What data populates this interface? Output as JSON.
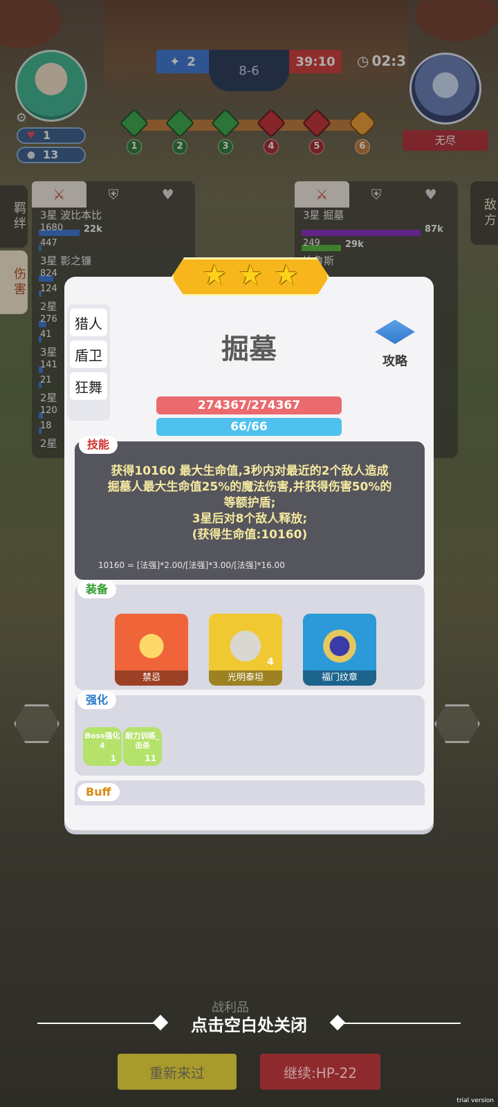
{
  "hud": {
    "lives": "1",
    "coins": "13",
    "score_blue": "2",
    "score_mid": "8-6",
    "score_red": "39:10",
    "timer": "02:3",
    "enemy_label": "无尽"
  },
  "stages": [
    {
      "num": "1",
      "state": "green"
    },
    {
      "num": "2",
      "state": "green"
    },
    {
      "num": "3",
      "state": "green"
    },
    {
      "num": "4",
      "state": "red"
    },
    {
      "num": "5",
      "state": "red"
    },
    {
      "num": "6",
      "state": "skull"
    }
  ],
  "side_tabs": {
    "left_top": "羁绊",
    "left_active": "伤害",
    "right": "敌方"
  },
  "left_panel": {
    "rows": [
      {
        "type": "name",
        "text": "3星 波比本比"
      },
      {
        "type": "bar",
        "text": "1680",
        "value": "22k",
        "color": "#3d78d6",
        "fill": 0.28
      },
      {
        "type": "bar",
        "text": "447",
        "value": "",
        "color": "#3d78d6",
        "fill": 0.02
      },
      {
        "type": "name",
        "text": "3星 影之镰"
      },
      {
        "type": "bar",
        "text": "824",
        "value": "",
        "color": "#3d78d6",
        "fill": 0.1
      },
      {
        "type": "bar",
        "text": "124",
        "value": "",
        "color": "#3d78d6",
        "fill": 0.02
      },
      {
        "type": "name",
        "text": "2星"
      },
      {
        "type": "bar",
        "text": "276",
        "value": "",
        "color": "#3d78d6",
        "fill": 0.05
      },
      {
        "type": "bar",
        "text": "41",
        "value": "",
        "color": "#3d78d6",
        "fill": 0.02
      },
      {
        "type": "name",
        "text": "3星"
      },
      {
        "type": "bar",
        "text": "141",
        "value": "",
        "color": "#3d78d6",
        "fill": 0.03
      },
      {
        "type": "bar",
        "text": "21",
        "value": "",
        "color": "#3d78d6",
        "fill": 0.02
      },
      {
        "type": "name",
        "text": "2星"
      },
      {
        "type": "bar",
        "text": "120",
        "value": "",
        "color": "#3d78d6",
        "fill": 0.03
      },
      {
        "type": "bar",
        "text": "18",
        "value": "",
        "color": "#3d78d6",
        "fill": 0.02
      },
      {
        "type": "name",
        "text": "2星"
      }
    ]
  },
  "right_panel": {
    "rows": [
      {
        "type": "name",
        "text": "3星 掘墓"
      },
      {
        "type": "bar",
        "text": "",
        "value": "87k",
        "color": "#8a2ec8",
        "fill": 0.82
      },
      {
        "type": "bar",
        "text": "249",
        "value": "29k",
        "color": "#58b83a",
        "fill": 0.27
      },
      {
        "type": "name",
        "text": "比鲁斯"
      }
    ]
  },
  "modal": {
    "traits": [
      "猎人",
      "盾卫",
      "狂舞"
    ],
    "hero_name": "掘墓",
    "guide_label": "攻略",
    "hp_text": "274367/274367",
    "mp_text": "66/66",
    "skill": {
      "tag": "技能",
      "lines": [
        "获得10160 最大生命值,3秒内对最近的2个敌人造成",
        "掘墓人最大生命值25%的魔法伤害,并获得伤害50%的",
        "等额护盾;",
        "3星后对8个敌人释放;",
        "(获得生命值:10160)"
      ],
      "formula": "10160 = [法强]*2.00/[法强]*3.00/[法强]*16.00"
    },
    "equipment": {
      "tag": "装备",
      "items": [
        {
          "name": "禁忌",
          "count": "",
          "color": "#f0643a"
        },
        {
          "name": "光明泰坦",
          "count": "4",
          "color": "#f0c832"
        },
        {
          "name": "福门纹章",
          "count": "",
          "color": "#2c9ad8"
        }
      ]
    },
    "boosts": {
      "tag": "强化",
      "items": [
        {
          "label": "Boss强化4",
          "count": "1"
        },
        {
          "label": "耐力训练_击杀",
          "count": "11"
        }
      ]
    },
    "buff_tag": "Buff"
  },
  "bottom": {
    "loot_label": "战利品",
    "close_hint": "点击空白处关闭",
    "retry_button": "重新来过",
    "continue_button": "继续:HP-22",
    "trial": "trial version"
  }
}
